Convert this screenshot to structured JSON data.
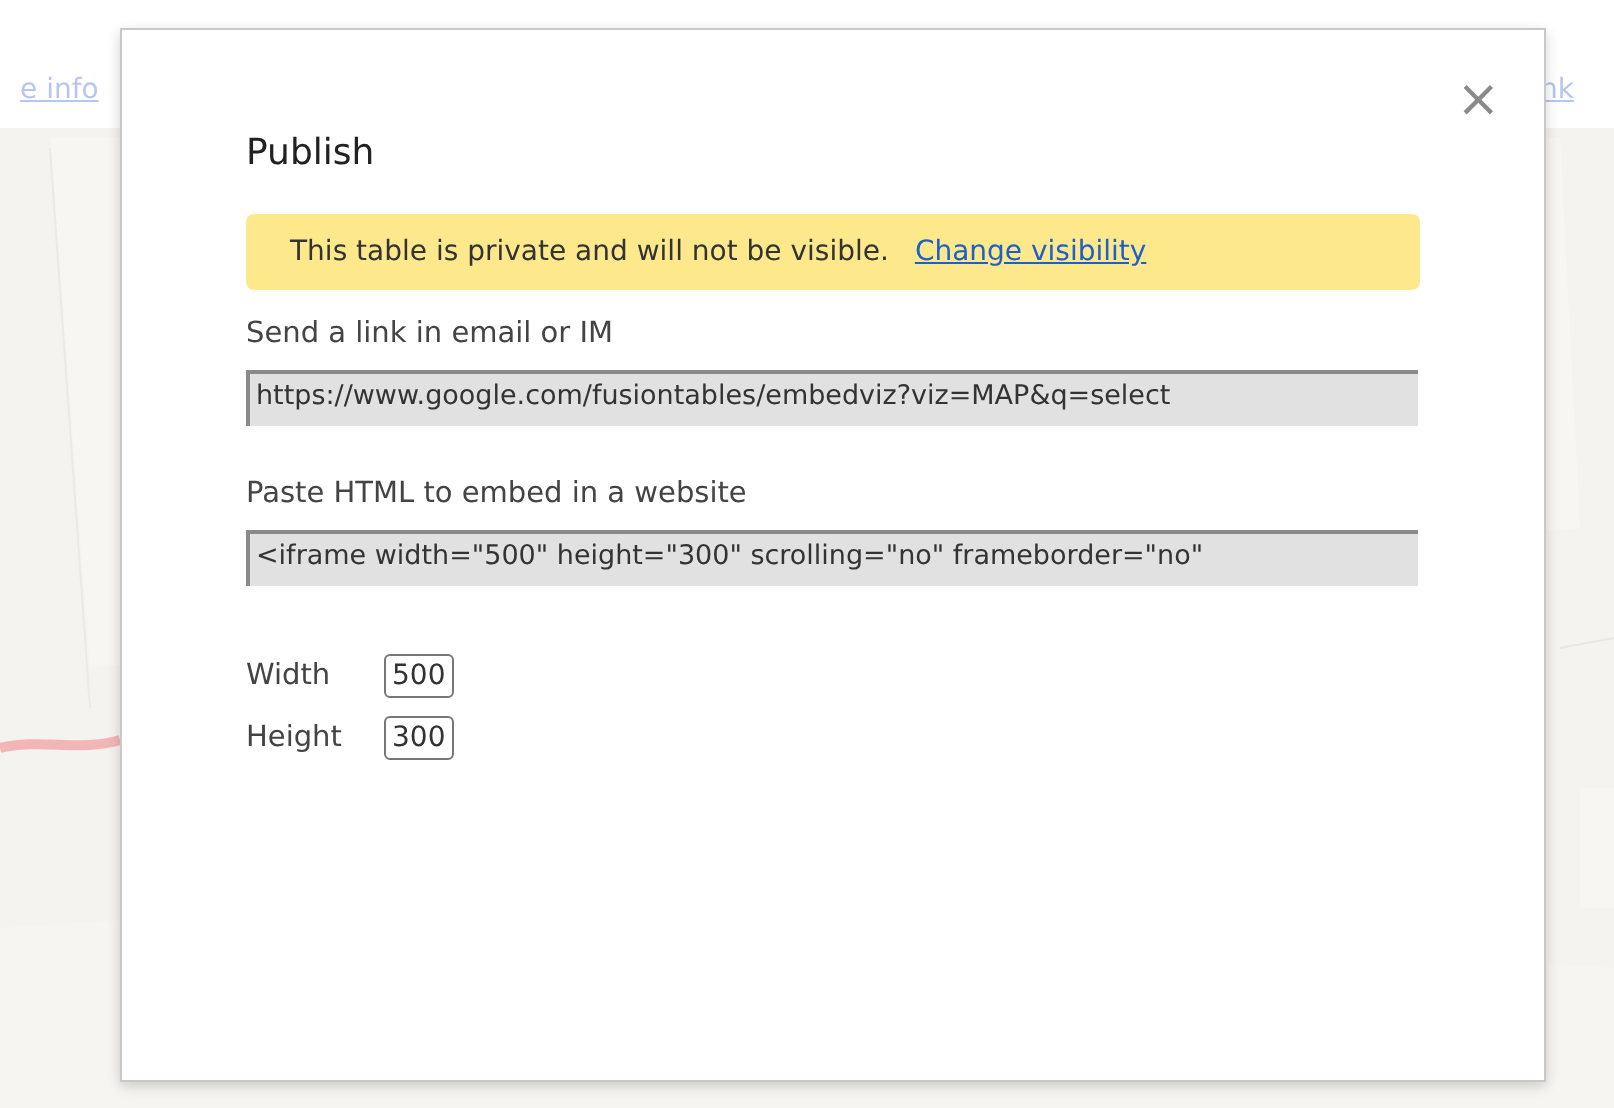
{
  "background": {
    "links": [
      "e info",
      "nk"
    ]
  },
  "dialog": {
    "title": "Publish",
    "close": "×",
    "notice": {
      "text": "This table is private and will not be visible.",
      "link": "Change visibility"
    },
    "share_link": {
      "label": "Send a link in email or IM",
      "value": "https://www.google.com/fusiontables/embedviz?viz=MAP&q=select"
    },
    "embed": {
      "label": "Paste HTML to embed in a website",
      "value": "<iframe width=\"500\" height=\"300\" scrolling=\"no\" frameborder=\"no\""
    },
    "size_fields": [
      {
        "label": "Width",
        "value": "500"
      },
      {
        "label": "Height",
        "value": "300"
      }
    ]
  }
}
